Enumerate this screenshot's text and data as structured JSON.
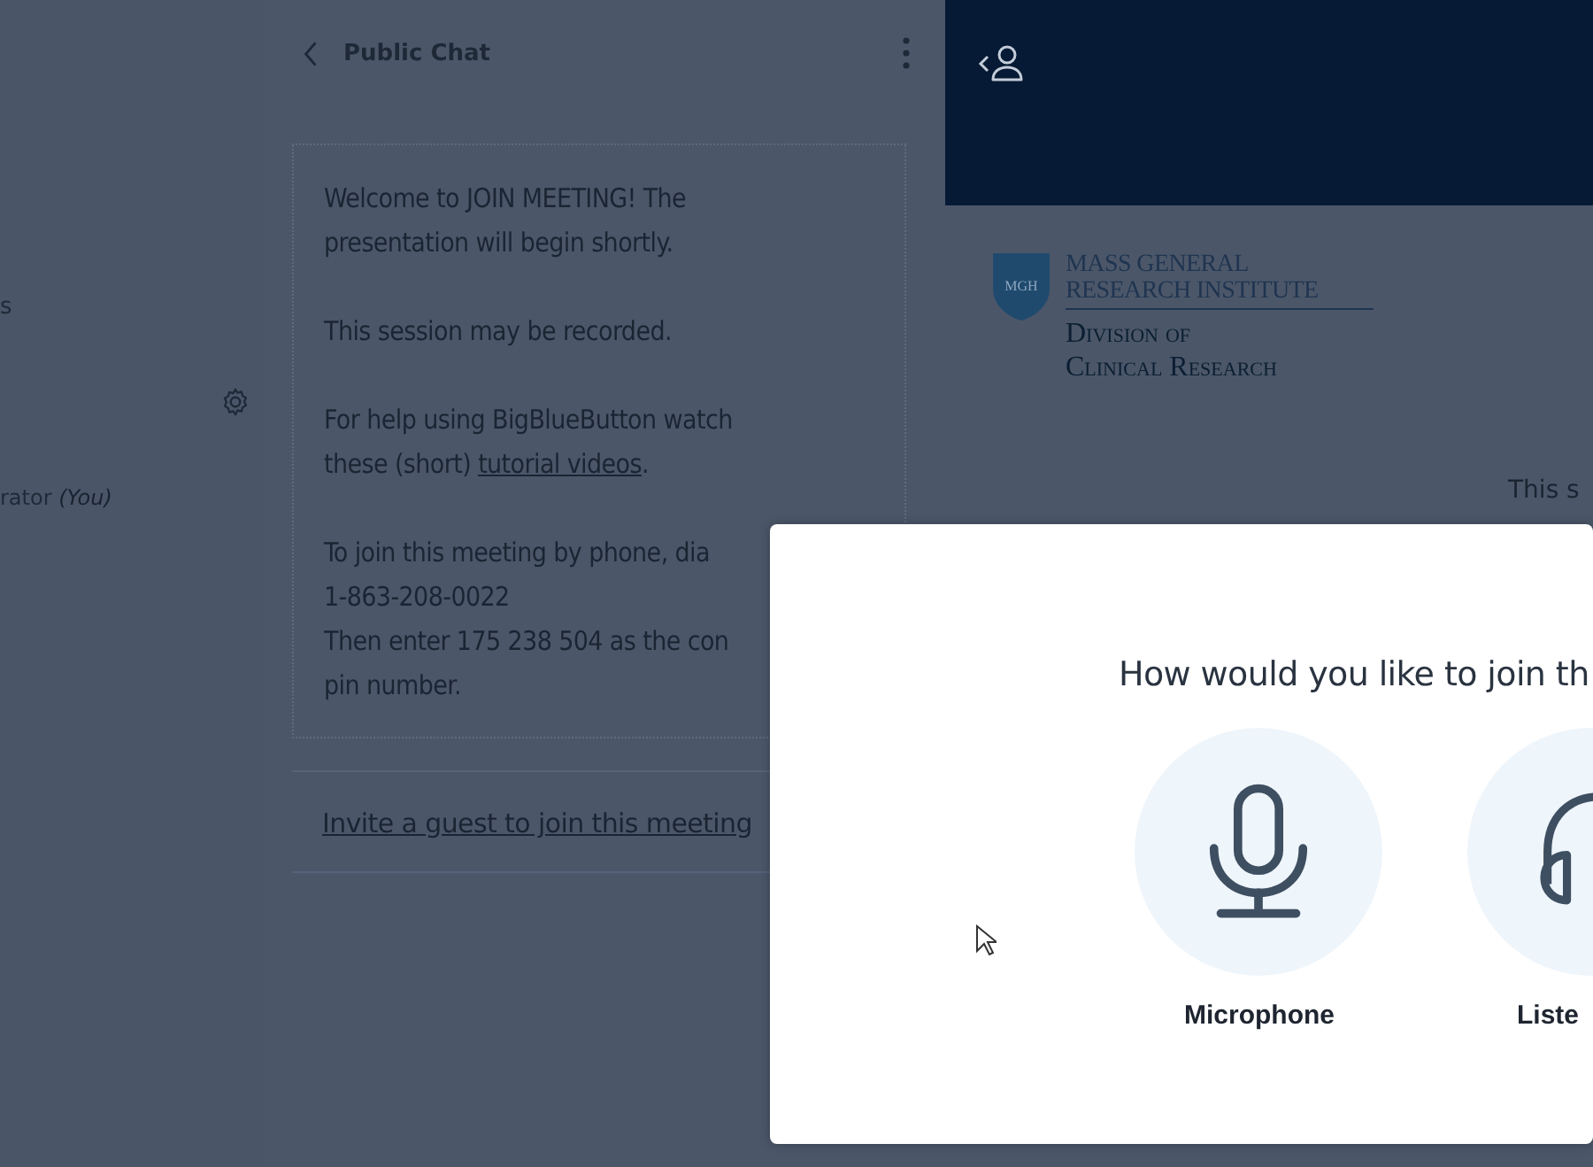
{
  "userlist": {
    "section_label": "s",
    "user": {
      "name": "rator",
      "suffix": "(You)"
    }
  },
  "chat": {
    "title": "Public Chat",
    "paragraphs": [
      [
        [
          {
            "kind": "text",
            "text": "Welcome to JOIN MEETING! The"
          }
        ],
        [
          {
            "kind": "text",
            "text": "presentation will begin shortly."
          }
        ]
      ],
      [
        [
          {
            "kind": "text",
            "text": "This session may be recorded."
          }
        ]
      ],
      [
        [
          {
            "kind": "text",
            "text": "For help using BigBlueButton watch"
          }
        ],
        [
          {
            "kind": "text",
            "text": "these (short) "
          },
          {
            "kind": "link",
            "text": "tutorial videos"
          },
          {
            "kind": "text",
            "text": "."
          }
        ]
      ],
      [
        [
          {
            "kind": "text",
            "text": "To join this meeting by phone, dia"
          }
        ],
        [
          {
            "kind": "text",
            "text": "1-863-208-0022"
          }
        ],
        [
          {
            "kind": "text",
            "text": "Then enter 175 238 504 as the con"
          }
        ],
        [
          {
            "kind": "text",
            "text": "pin number."
          }
        ]
      ]
    ],
    "invite_link": "Invite a guest to join this meeting"
  },
  "presentation": {
    "logo": {
      "shield": "MGH",
      "line_1": "MASS GENERAL",
      "line_2": "RESEARCH INSTITUTE",
      "line_3": "Division of",
      "line_4": "Clinical Research"
    },
    "slide_text": "This s"
  },
  "modal": {
    "title": "How would you like to join th",
    "options": [
      {
        "kind": "microphone",
        "label": "Microphone"
      },
      {
        "kind": "headphones",
        "label": "Liste"
      }
    ]
  }
}
